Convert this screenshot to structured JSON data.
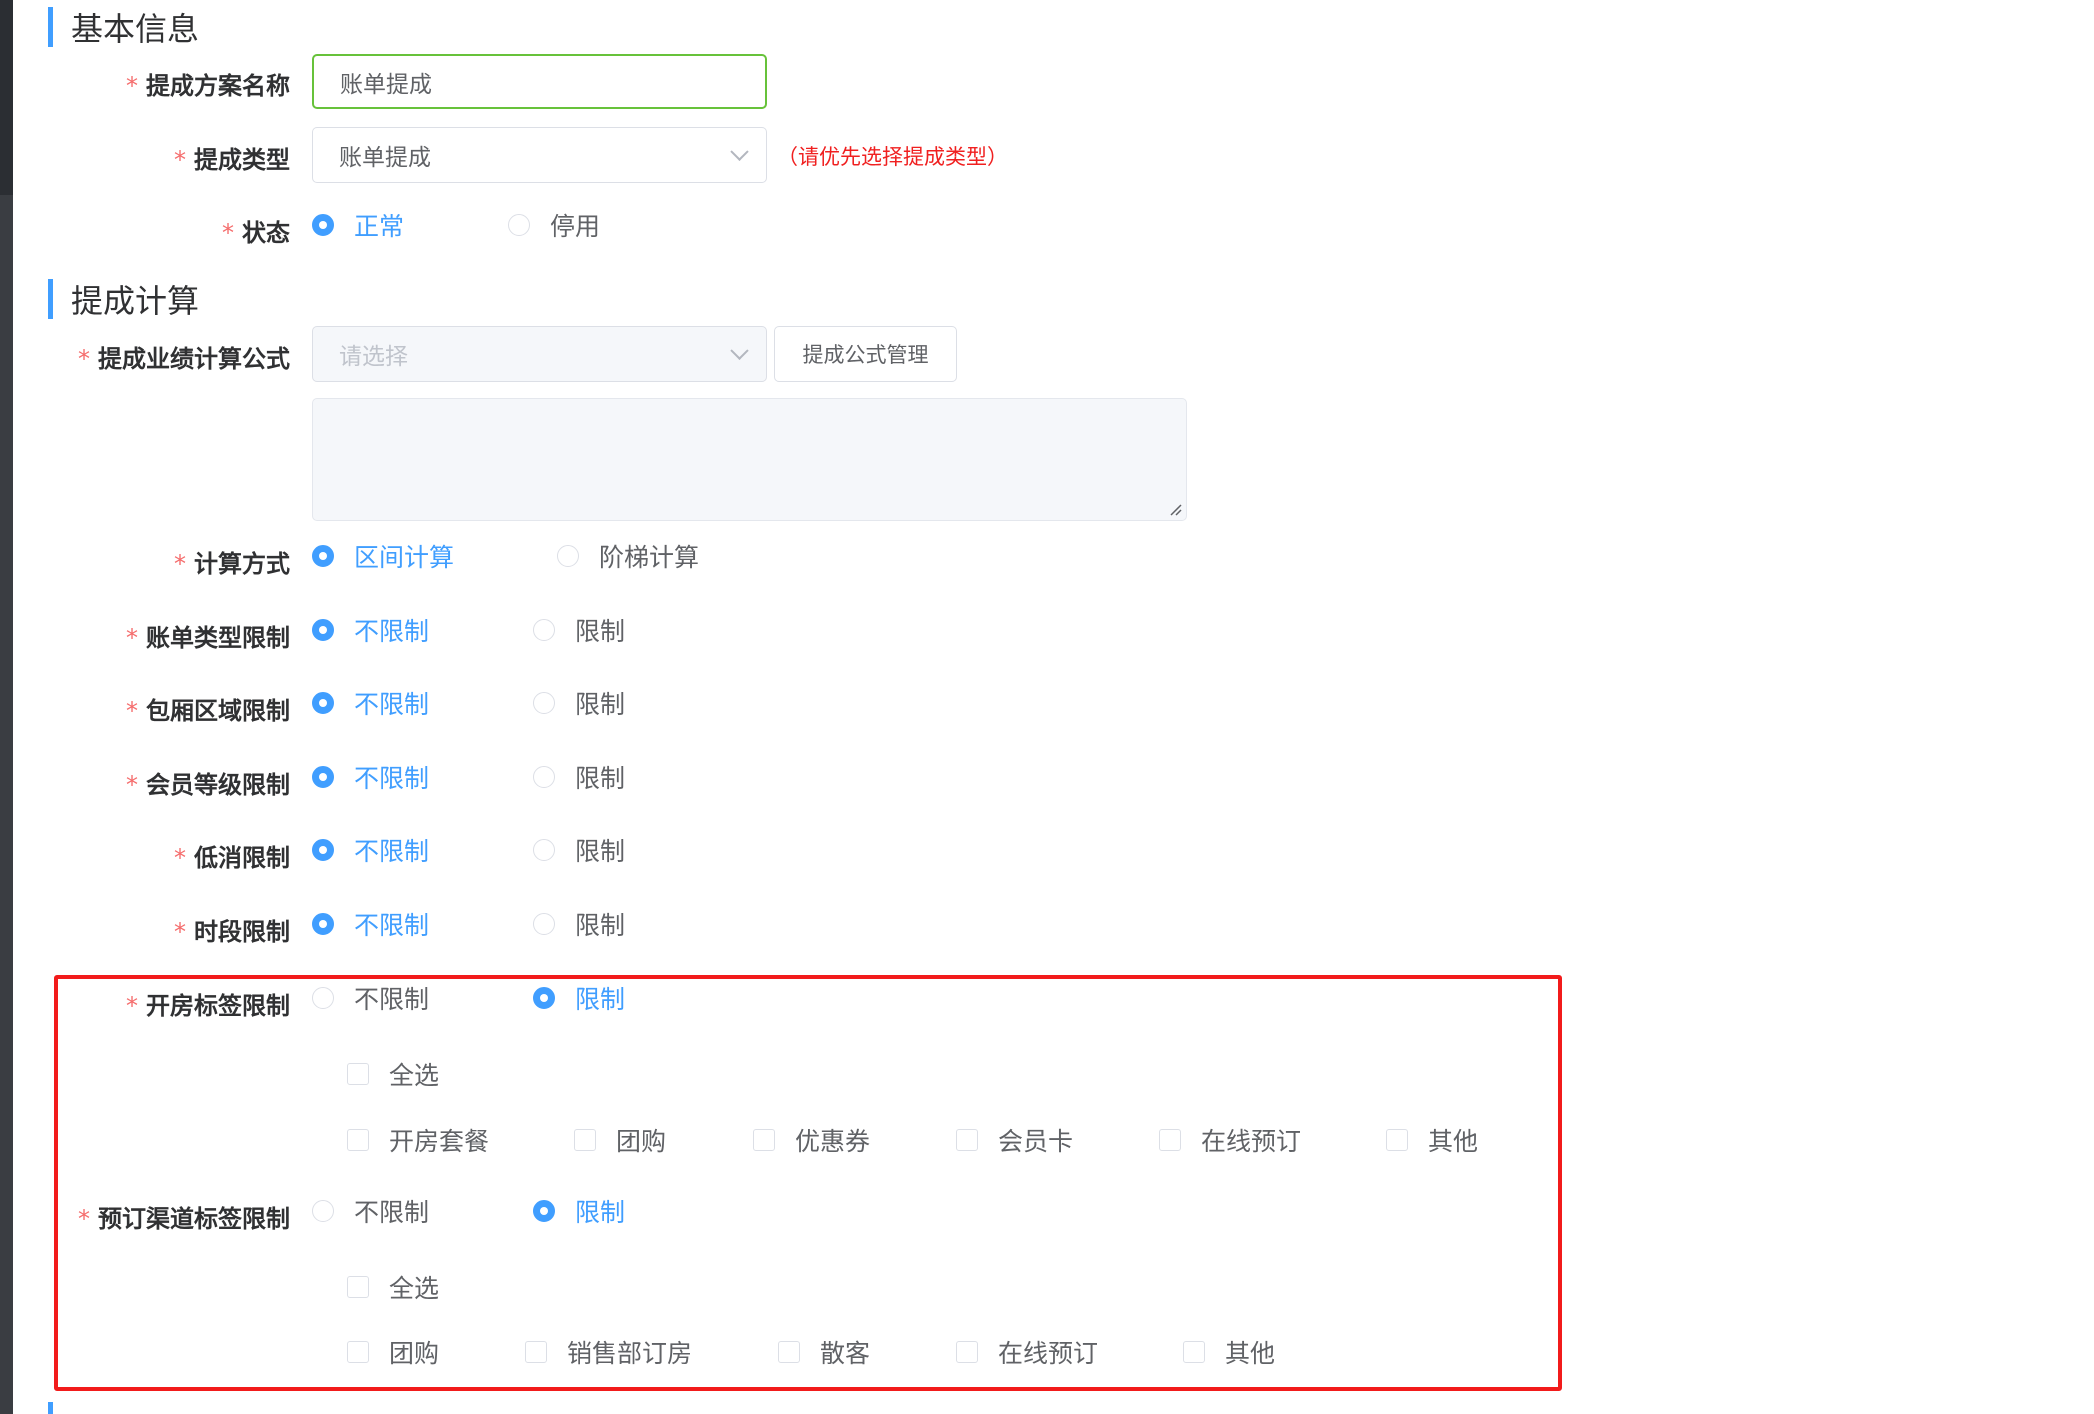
{
  "basic": {
    "section_title": "基本信息",
    "name": {
      "label": "提成方案名称",
      "value": "账单提成"
    },
    "type": {
      "label": "提成类型",
      "value": "账单提成",
      "hint": "（请优先选择提成类型）"
    },
    "status": {
      "label": "状态",
      "options": [
        "正常",
        "停用"
      ],
      "selected": "正常"
    }
  },
  "calc": {
    "section_title": "提成计算",
    "formula": {
      "label": "提成业绩计算公式",
      "placeholder": "请选择",
      "manage_button": "提成公式管理"
    },
    "method": {
      "label": "计算方式",
      "options": [
        "区间计算",
        "阶梯计算"
      ],
      "selected": "区间计算"
    },
    "restrictions": [
      {
        "label": "账单类型限制",
        "options": [
          "不限制",
          "限制"
        ],
        "selected": "不限制"
      },
      {
        "label": "包厢区域限制",
        "options": [
          "不限制",
          "限制"
        ],
        "selected": "不限制"
      },
      {
        "label": "会员等级限制",
        "options": [
          "不限制",
          "限制"
        ],
        "selected": "不限制"
      },
      {
        "label": "低消限制",
        "options": [
          "不限制",
          "限制"
        ],
        "selected": "不限制"
      },
      {
        "label": "时段限制",
        "options": [
          "不限制",
          "限制"
        ],
        "selected": "不限制"
      }
    ],
    "room_tag": {
      "label": "开房标签限制",
      "options": [
        "不限制",
        "限制"
      ],
      "selected": "限制",
      "select_all": "全选",
      "tags": [
        "开房套餐",
        "团购",
        "优惠券",
        "会员卡",
        "在线预订",
        "其他"
      ]
    },
    "channel_tag": {
      "label": "预订渠道标签限制",
      "options": [
        "不限制",
        "限制"
      ],
      "selected": "限制",
      "select_all": "全选",
      "tags": [
        "团购",
        "销售部订房",
        "散客",
        "在线预订",
        "其他"
      ]
    }
  },
  "colors": {
    "primary": "#409eff",
    "required": "#f56c6c",
    "highlight_border": "#f21b1b",
    "focus_border": "#67c23a"
  }
}
